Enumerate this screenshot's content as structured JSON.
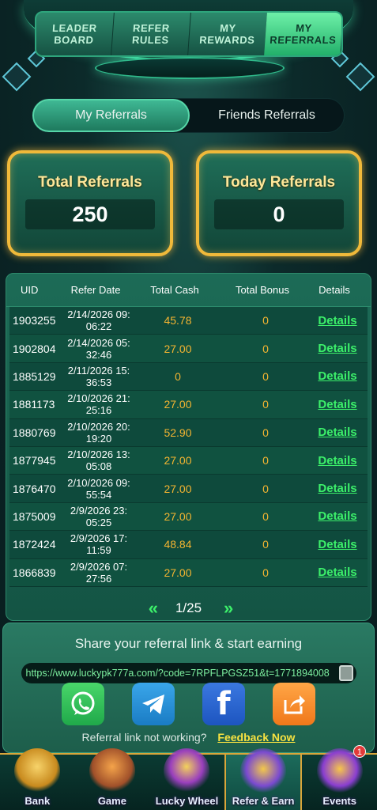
{
  "top_tabs": [
    {
      "label": "LEADER\nBOARD"
    },
    {
      "label": "REFER\nRULES"
    },
    {
      "label": "MY\nREWARDS"
    },
    {
      "label": "MY\nREFERRALS",
      "active": true
    }
  ],
  "toggle": {
    "my_referrals": "My Referrals",
    "friends_referrals": "Friends Referrals"
  },
  "stats": {
    "total_title": "Total Referrals",
    "total_value": "250",
    "today_title": "Today Referrals",
    "today_value": "0"
  },
  "table": {
    "headers": {
      "uid": "UID",
      "date": "Refer Date",
      "cash": "Total Cash",
      "bonus": "Total Bonus",
      "details": "Details"
    },
    "rows": [
      {
        "uid": "1903255",
        "date": "2/14/2026 09:\n06:22",
        "cash": "45.78",
        "bonus": "0",
        "details": "Details"
      },
      {
        "uid": "1902804",
        "date": "2/14/2026 05:\n32:46",
        "cash": "27.00",
        "bonus": "0",
        "details": "Details"
      },
      {
        "uid": "1885129",
        "date": "2/11/2026 15:\n36:53",
        "cash": "0",
        "bonus": "0",
        "details": "Details"
      },
      {
        "uid": "1881173",
        "date": "2/10/2026 21:\n25:16",
        "cash": "27.00",
        "bonus": "0",
        "details": "Details"
      },
      {
        "uid": "1880769",
        "date": "2/10/2026 20:\n19:20",
        "cash": "52.90",
        "bonus": "0",
        "details": "Details"
      },
      {
        "uid": "1877945",
        "date": "2/10/2026 13:\n05:08",
        "cash": "27.00",
        "bonus": "0",
        "details": "Details"
      },
      {
        "uid": "1876470",
        "date": "2/10/2026 09:\n55:54",
        "cash": "27.00",
        "bonus": "0",
        "details": "Details"
      },
      {
        "uid": "1875009",
        "date": "2/9/2026 23:\n05:25",
        "cash": "27.00",
        "bonus": "0",
        "details": "Details"
      },
      {
        "uid": "1872424",
        "date": "2/9/2026 17:\n11:59",
        "cash": "48.84",
        "bonus": "0",
        "details": "Details"
      },
      {
        "uid": "1866839",
        "date": "2/9/2026 07:\n27:56",
        "cash": "27.00",
        "bonus": "0",
        "details": "Details"
      }
    ]
  },
  "pager": {
    "prev": "«",
    "page": "1/25",
    "next": "»"
  },
  "share": {
    "title": "Share your referral link & start earning",
    "link": "https://www.luckypk777a.com/?code=7RPFLPGSZ51&t=1771894008",
    "socials": [
      {
        "name": "whatsapp-icon",
        "color": "#2fbf55"
      },
      {
        "name": "telegram-icon",
        "color": "#2a90d8"
      },
      {
        "name": "facebook-icon",
        "color": "#2d66d0",
        "glyph": "f"
      },
      {
        "name": "share-external-icon",
        "color": "#f58a2a"
      }
    ],
    "not_working": "Referral link not working?",
    "feedback": "Feedback Now"
  },
  "bottom_nav": [
    {
      "label": "Bank",
      "icon": "bank-icon"
    },
    {
      "label": "Game",
      "icon": "slot-machine-icon"
    },
    {
      "label": "Lucky Wheel",
      "icon": "wheel-icon"
    },
    {
      "label": "Refer & Earn",
      "icon": "refer-earn-icon",
      "active": true
    },
    {
      "label": "Events",
      "icon": "gift-icon",
      "badge": "1"
    }
  ]
}
